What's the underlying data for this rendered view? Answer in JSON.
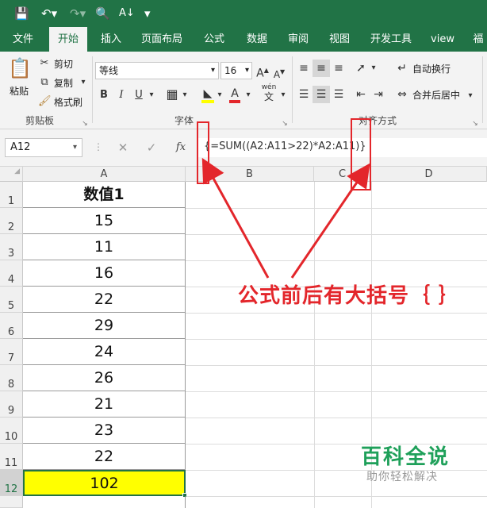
{
  "qat": {
    "save_icon": "save-icon",
    "undo_icon": "undo-icon",
    "redo_icon": "redo-icon",
    "preview_icon": "print-preview-icon",
    "sort_icon": "sort-az-icon",
    "customize_icon": "customize-qat-icon"
  },
  "tabs": [
    {
      "label": "文件"
    },
    {
      "label": "开始"
    },
    {
      "label": "插入"
    },
    {
      "label": "页面布局"
    },
    {
      "label": "公式"
    },
    {
      "label": "数据"
    },
    {
      "label": "审阅"
    },
    {
      "label": "视图"
    },
    {
      "label": "开发工具"
    },
    {
      "label": "view"
    },
    {
      "label": "福"
    }
  ],
  "ribbon": {
    "clipboard": {
      "paste": "粘贴",
      "cut": "剪切",
      "copy": "复制",
      "format_painter": "格式刷",
      "group_label": "剪贴板"
    },
    "font": {
      "font_name": "等线",
      "font_size": "16",
      "bold": "B",
      "italic": "I",
      "underline": "U",
      "grow": "A",
      "shrink": "A",
      "font_color": "A",
      "phonetic_top": "wén",
      "phonetic_bottom": "文",
      "group_label": "字体"
    },
    "alignment": {
      "wrap_text": "自动换行",
      "merge_center": "合并后居中",
      "group_label": "对齐方式"
    }
  },
  "formula_bar": {
    "name_box": "A12",
    "cancel": "✕",
    "enter": "✓",
    "fx": "fx",
    "formula": "{=SUM((A2:A11>22)*A2:A11)}"
  },
  "grid": {
    "columns": [
      "A",
      "B",
      "C",
      "D"
    ],
    "rows": [
      "1",
      "2",
      "3",
      "4",
      "5",
      "6",
      "7",
      "8",
      "9",
      "10",
      "11",
      "12"
    ],
    "header_cell": "数值1",
    "values": [
      "15",
      "11",
      "16",
      "22",
      "29",
      "24",
      "26",
      "21",
      "23",
      "22"
    ],
    "total": "102",
    "total_fill": "#ffff00"
  },
  "annotation": {
    "callout": "公式前后有大括号｛ ｝",
    "color": "#e3262b"
  },
  "watermark": {
    "title": "百科全说",
    "subtitle": "助你轻松解决"
  }
}
